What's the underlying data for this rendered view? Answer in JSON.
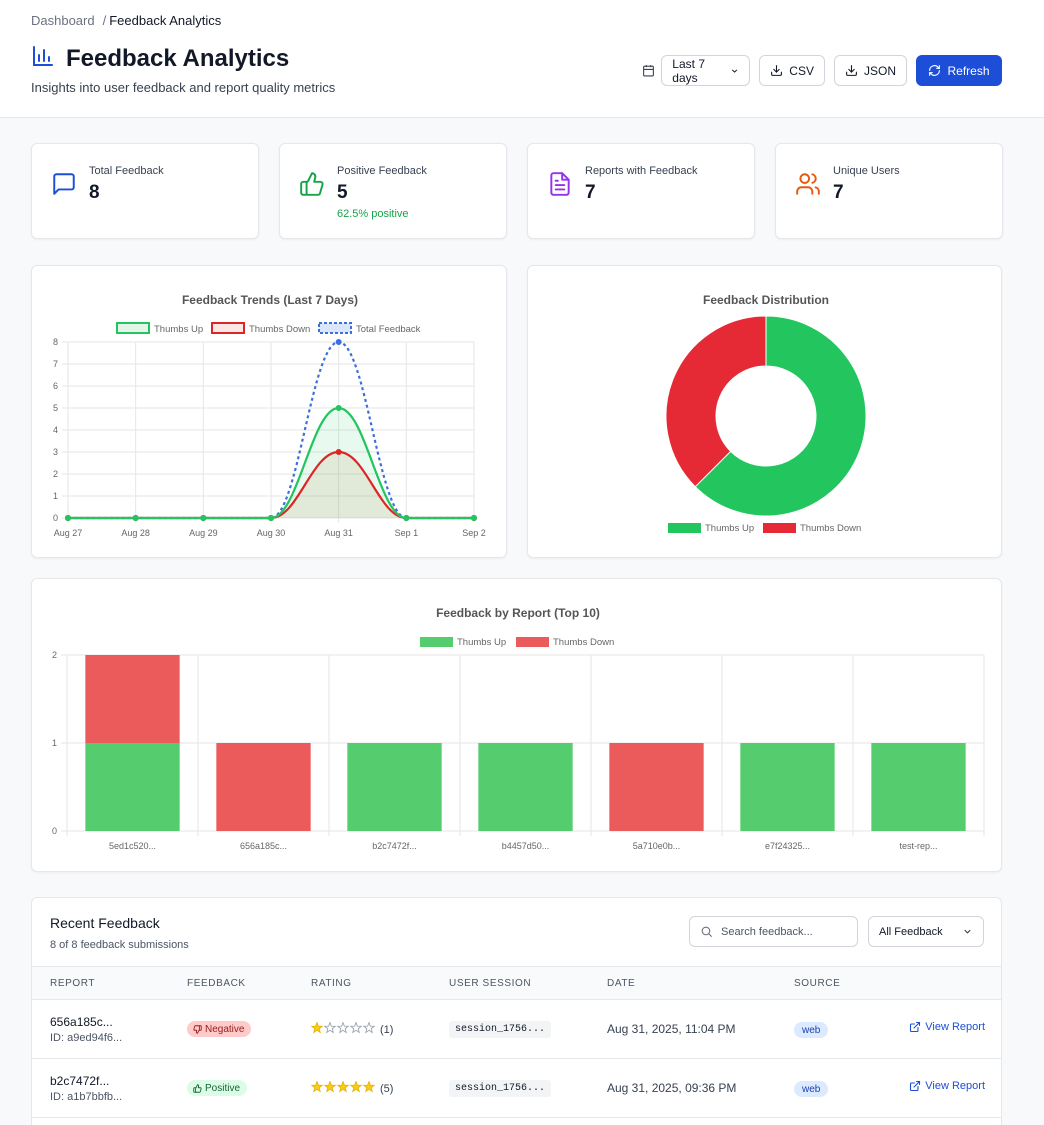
{
  "header": {
    "breadcrumb": {
      "home": "Dashboard",
      "separator": "/",
      "current": "Feedback Analytics"
    },
    "title": "Feedback Analytics",
    "subtitle": "Insights into user feedback and report quality metrics",
    "date_range": "Last 7 days",
    "csv_label": "CSV",
    "json_label": "JSON",
    "refresh_label": "Refresh"
  },
  "stats": [
    {
      "label": "Total Feedback",
      "value": "8",
      "icon": "chat-bubble-icon",
      "color": "#1d4ed8"
    },
    {
      "label": "Positive Feedback",
      "value": "5",
      "sub": "62.5% positive",
      "icon": "thumbs-up-icon",
      "color": "#16a34a"
    },
    {
      "label": "Reports with Feedback",
      "value": "7",
      "icon": "document-icon",
      "color": "#9333ea"
    },
    {
      "label": "Unique Users",
      "value": "7",
      "icon": "users-icon",
      "color": "#ea580c"
    }
  ],
  "chart_data": [
    {
      "type": "line",
      "title": "Feedback Trends (Last 7 Days)",
      "x": [
        "Aug 27",
        "Aug 28",
        "Aug 29",
        "Aug 30",
        "Aug 31",
        "Sep 1",
        "Sep 2"
      ],
      "ylim": [
        0,
        8
      ],
      "yticks": [
        0,
        1,
        2,
        3,
        4,
        5,
        6,
        7,
        8
      ],
      "grid": true,
      "legend": "top",
      "series": [
        {
          "name": "Thumbs Up",
          "values": [
            0,
            0,
            0,
            0,
            5,
            0,
            0
          ],
          "color": "#22c55e",
          "fill": true
        },
        {
          "name": "Thumbs Down",
          "values": [
            0,
            0,
            0,
            0,
            3,
            0,
            0
          ],
          "color": "#dc2626",
          "fill": true
        },
        {
          "name": "Total Feedback",
          "values": [
            0,
            0,
            0,
            0,
            8,
            0,
            0
          ],
          "color": "#3b6fe0",
          "dashed": true
        }
      ]
    },
    {
      "type": "pie",
      "title": "Feedback Distribution",
      "legend": "bottom",
      "categories": [
        "Thumbs Up",
        "Thumbs Down"
      ],
      "values": [
        5,
        3
      ],
      "colors": [
        "#22c55e",
        "#e52a36"
      ]
    },
    {
      "type": "bar",
      "title": "Feedback by Report (Top 10)",
      "stacked": true,
      "legend": "top",
      "categories": [
        "5ed1c520...",
        "656a185c...",
        "b2c7472f...",
        "b4457d50...",
        "5a710e0b...",
        "e7f24325...",
        "test-rep..."
      ],
      "ylim": [
        0,
        2
      ],
      "yticks": [
        0,
        1,
        2
      ],
      "series": [
        {
          "name": "Thumbs Up",
          "values": [
            1,
            0,
            1,
            1,
            0,
            1,
            1
          ],
          "color": "#55cc6d"
        },
        {
          "name": "Thumbs Down",
          "values": [
            1,
            1,
            0,
            0,
            1,
            0,
            0
          ],
          "color": "#ec5b5c"
        }
      ]
    }
  ],
  "recent": {
    "title": "Recent Feedback",
    "subtitle": "8 of 8 feedback submissions",
    "search_placeholder": "Search feedback...",
    "filter": "All Feedback",
    "columns": [
      "REPORT",
      "FEEDBACK",
      "RATING",
      "USER SESSION",
      "DATE",
      "SOURCE"
    ],
    "rows": [
      {
        "report": "656a185c...",
        "id": "ID: a9ed94f6...",
        "feedback": "Negative",
        "stars": 1,
        "rating": "(1)",
        "session": "session_1756...",
        "date": "Aug 31, 2025, 11:04 PM",
        "source": "web",
        "action": "View Report"
      },
      {
        "report": "b2c7472f...",
        "id": "ID: a1b7bbfb...",
        "feedback": "Positive",
        "stars": 5,
        "rating": "(5)",
        "session": "session_1756...",
        "date": "Aug 31, 2025, 09:36 PM",
        "source": "web",
        "action": "View Report"
      }
    ]
  }
}
